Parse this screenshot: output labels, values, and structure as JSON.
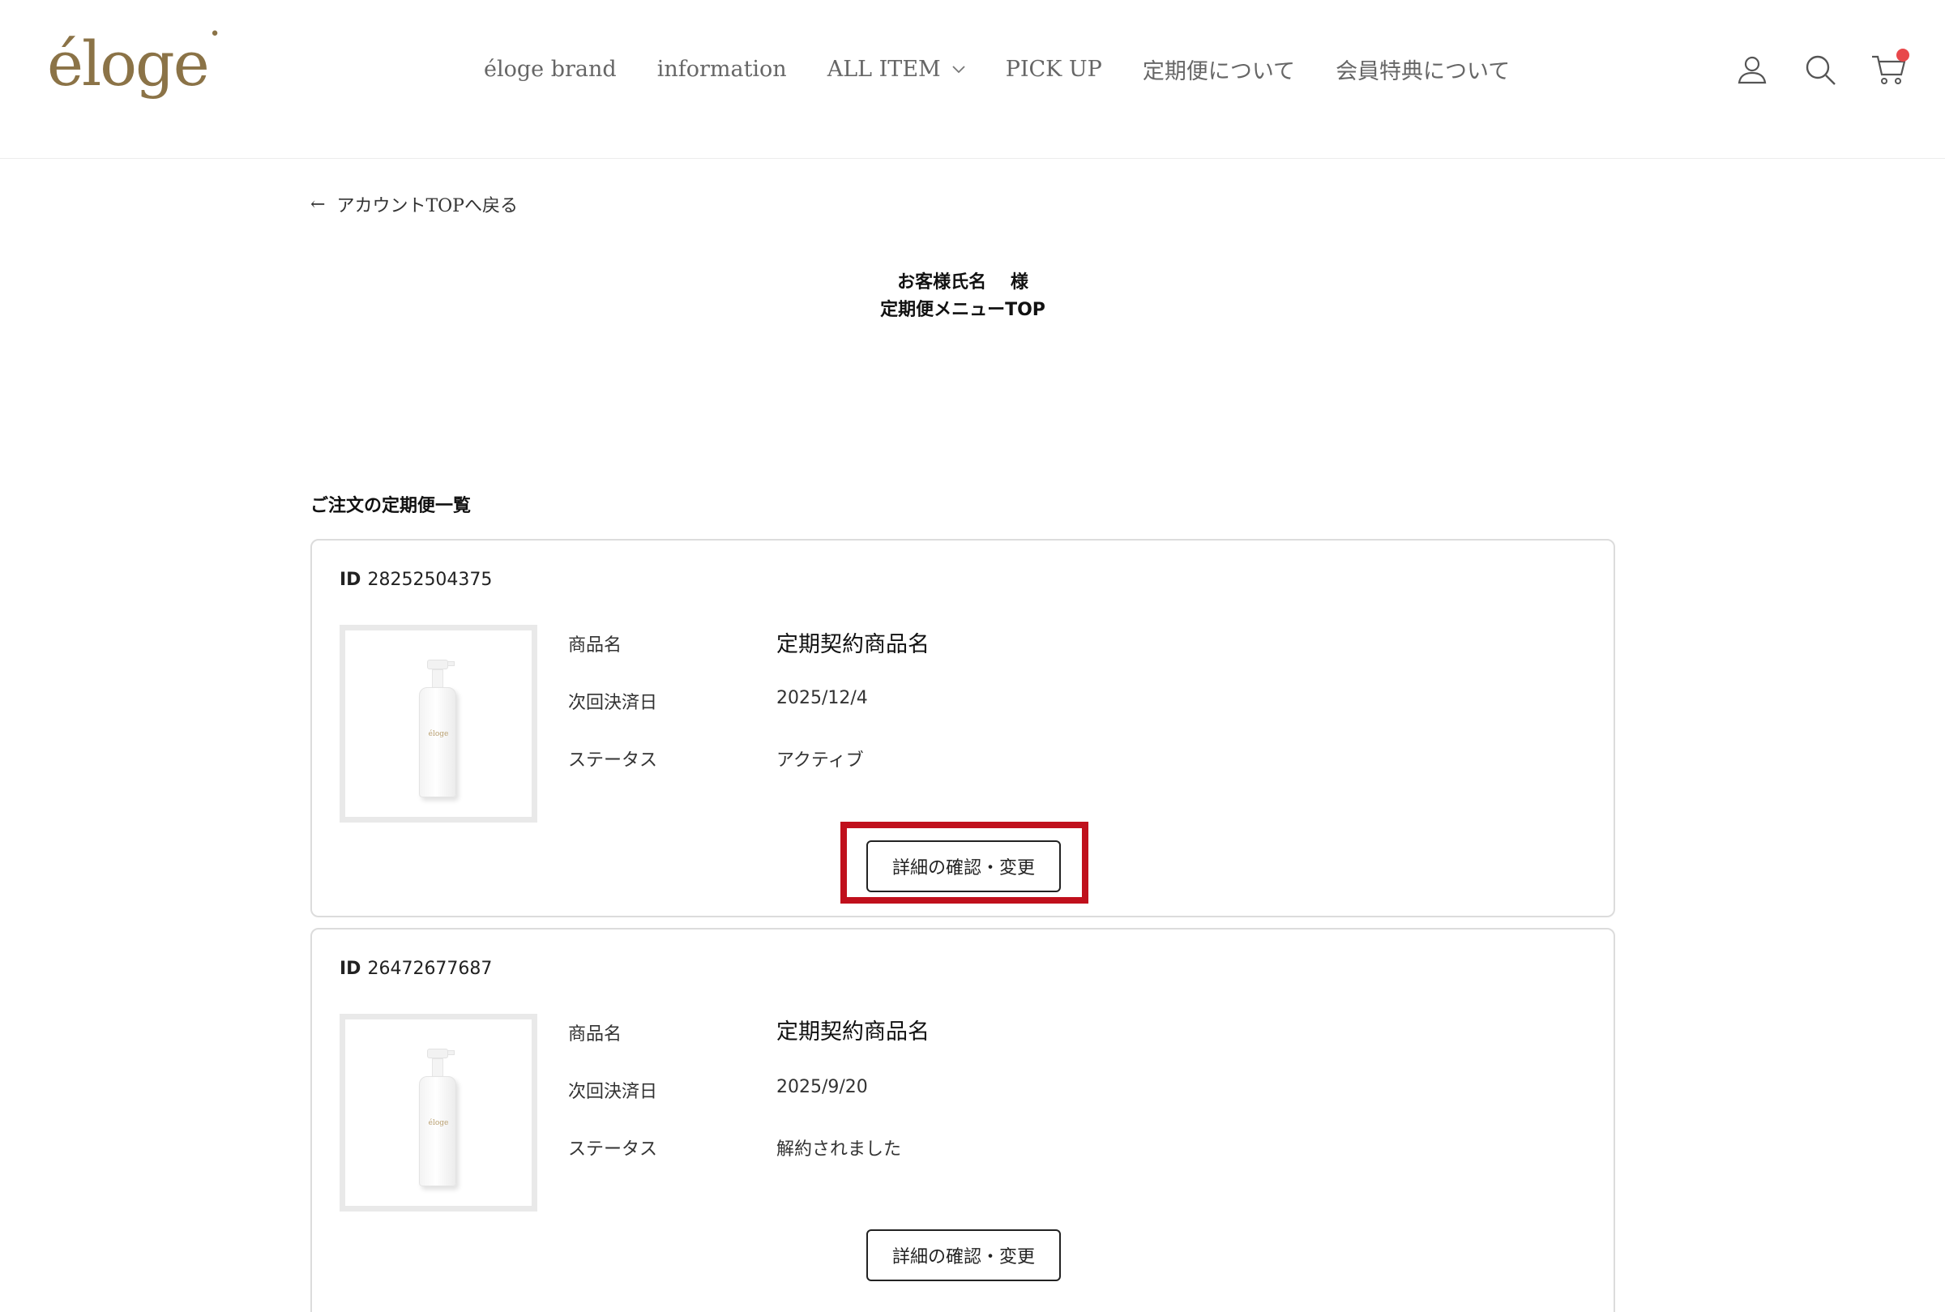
{
  "header": {
    "logo": "éloge",
    "nav": [
      {
        "label": "éloge brand",
        "has_dropdown": false
      },
      {
        "label": "information",
        "has_dropdown": false
      },
      {
        "label": "ALL ITEM",
        "has_dropdown": true
      },
      {
        "label": "PICK UP",
        "has_dropdown": false
      },
      {
        "label": "定期便について",
        "has_dropdown": false
      },
      {
        "label": "会員特典について",
        "has_dropdown": false
      }
    ],
    "icons": [
      "account-icon",
      "search-icon",
      "cart-icon"
    ],
    "cart_badge_color": "#e8484b"
  },
  "back_link": "アカウントTOPへ戻る",
  "page": {
    "customer_line": "お客様氏名　 様",
    "title": "定期便メニューTOP"
  },
  "subscriptions_heading": "ご注文の定期便一覧",
  "labels": {
    "id": "ID",
    "product": "商品名",
    "next_payment": "次回決済日",
    "status": "ステータス",
    "detail_button": "詳細の確認・変更"
  },
  "subscriptions": [
    {
      "id": "28252504375",
      "product_name": "定期契約商品名",
      "next_payment_date": "2025/12/4",
      "status": "アクティブ",
      "thumbnail_brand": "éloge"
    },
    {
      "id": "26472677687",
      "product_name": "定期契約商品名",
      "next_payment_date": "2025/9/20",
      "status": "解約されました",
      "thumbnail_brand": "éloge"
    }
  ],
  "colors": {
    "brand_gold": "#8b7347",
    "highlight_red": "#c0101c"
  }
}
